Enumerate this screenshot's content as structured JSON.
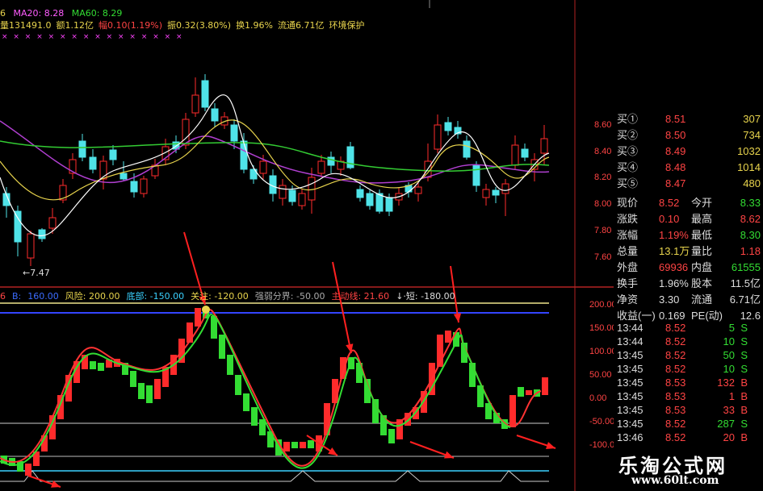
{
  "top_header": {
    "ma_partial": "6",
    "ma20": "MA20: 8.28",
    "ma60": "MA60: 8.29",
    "line2": [
      {
        "text": "量131491.0",
        "color": "#e8d44d"
      },
      {
        "text": "额1.12亿",
        "color": "#e8d44d"
      },
      {
        "text": "幅0.10(1.19%)",
        "color": "#ff4444"
      },
      {
        "text": "振0.32(3.80%)",
        "color": "#e8d44d"
      },
      {
        "text": "换1.96%",
        "color": "#e8d44d"
      },
      {
        "text": "流通6.71亿",
        "color": "#e8d44d"
      },
      {
        "text": "环境保护",
        "color": "#e8d44d"
      }
    ],
    "markers": "× × × × × × × × × × × × × × × ×"
  },
  "indicator_header": [
    {
      "text": "6",
      "color": "#ff4444"
    },
    {
      "text": "B:",
      "color": "#3b6cff"
    },
    {
      "text": "160.00",
      "color": "#3b6cff"
    },
    {
      "text": "风险: 200.00",
      "color": "#e8d44d"
    },
    {
      "text": "底部: -150.00",
      "color": "#3ad1ff"
    },
    {
      "text": "关注: -120.00",
      "color": "#e8d44d"
    },
    {
      "text": "强弱分界: -50.00",
      "color": "#aaaaaa"
    },
    {
      "text": "主动线: 21.60",
      "color": "#ff4444"
    },
    {
      "text": "↓·短: -180.00",
      "color": "#dddddd"
    }
  ],
  "price_axis": [
    "8.60",
    "8.40",
    "8.20",
    "8.00",
    "7.80",
    "7.60"
  ],
  "indicator_axis": [
    "200.00",
    "150.00",
    "100.00",
    "50.00",
    "0.00",
    "-50.00",
    "-100.00"
  ],
  "low_label": "7.47",
  "order_book": [
    {
      "label": "买①",
      "price": "8.51",
      "vol": "307"
    },
    {
      "label": "买②",
      "price": "8.50",
      "vol": "734"
    },
    {
      "label": "买③",
      "price": "8.49",
      "vol": "1032"
    },
    {
      "label": "买④",
      "price": "8.48",
      "vol": "1014"
    },
    {
      "label": "买⑤",
      "price": "8.47",
      "vol": "480"
    }
  ],
  "stats": [
    {
      "l1": "现价",
      "v1": "8.52",
      "c1": "#ff4444",
      "l2": "今开",
      "v2": "8.33",
      "c2": "#33dd33"
    },
    {
      "l1": "涨跌",
      "v1": "0.10",
      "c1": "#ff4444",
      "l2": "最高",
      "v2": "8.62",
      "c2": "#ff4444"
    },
    {
      "l1": "涨幅",
      "v1": "1.19%",
      "c1": "#ff4444",
      "l2": "最低",
      "v2": "8.30",
      "c2": "#33dd33"
    },
    {
      "l1": "总量",
      "v1": "13.1万",
      "c1": "#e8d44d",
      "l2": "量比",
      "v2": "1.18",
      "c2": "#ff4444"
    },
    {
      "l1": "外盘",
      "v1": "69936",
      "c1": "#ff4444",
      "l2": "内盘",
      "v2": "61555",
      "c2": "#33dd33"
    },
    {
      "l1": "换手",
      "v1": "1.96%",
      "c1": "#dddddd",
      "l2": "股本",
      "v2": "11.5亿",
      "c2": "#dddddd"
    },
    {
      "l1": "净资",
      "v1": "3.30",
      "c1": "#dddddd",
      "l2": "流通",
      "v2": "6.71亿",
      "c2": "#dddddd"
    },
    {
      "l1": "收益(一)",
      "v1": "0.169",
      "c1": "#dddddd",
      "l2": "PE(动)",
      "v2": "12.6",
      "c2": "#dddddd"
    }
  ],
  "ticks": [
    {
      "time": "13:44",
      "price": "8.52",
      "vol": "5",
      "side": "S"
    },
    {
      "time": "13:44",
      "price": "8.52",
      "vol": "10",
      "side": "S"
    },
    {
      "time": "13:45",
      "price": "8.52",
      "vol": "50",
      "side": "S"
    },
    {
      "time": "13:45",
      "price": "8.52",
      "vol": "10",
      "side": "S"
    },
    {
      "time": "13:45",
      "price": "8.53",
      "vol": "132",
      "side": "B"
    },
    {
      "time": "13:45",
      "price": "8.53",
      "vol": "1",
      "side": "B"
    },
    {
      "time": "13:45",
      "price": "8.53",
      "vol": "33",
      "side": "B"
    },
    {
      "time": "13:45",
      "price": "8.52",
      "vol": "287",
      "side": "S"
    },
    {
      "time": "13:46",
      "price": "8.52",
      "vol": "20",
      "side": "B"
    }
  ],
  "watermark": {
    "title": "乐淘公式网",
    "url": "www.60lt.com"
  },
  "colors": {
    "up": "#ff2b2b",
    "down": "#33dd33",
    "candle_down": "#4fe3e8",
    "panel_border": "#b22222"
  }
}
